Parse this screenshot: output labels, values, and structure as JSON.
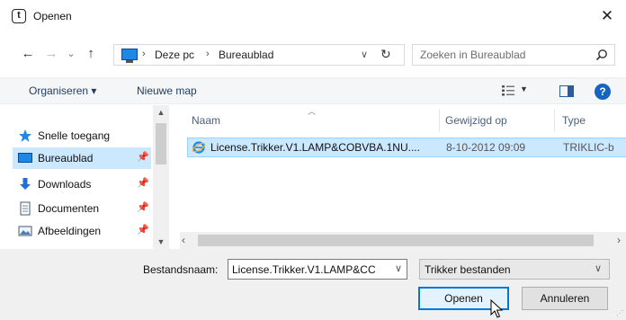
{
  "window": {
    "title": "Openen",
    "app_icon_letter": "t"
  },
  "nav": {
    "breadcrumbs": [
      "Deze pc",
      "Bureaublad"
    ],
    "search_placeholder": "Zoeken in Bureaublad"
  },
  "toolbar": {
    "organize": "Organiseren ▾",
    "new_folder": "Nieuwe map"
  },
  "sidebar": {
    "items": [
      {
        "label": "Snelle toegang"
      },
      {
        "label": "Bureaublad",
        "selected": true
      },
      {
        "label": "Downloads"
      },
      {
        "label": "Documenten"
      },
      {
        "label": "Afbeeldingen"
      }
    ]
  },
  "columns": [
    "Naam",
    "Gewijzigd op",
    "Type"
  ],
  "files": [
    {
      "name": "License.Trikker.V1.LAMP&COBVBA.1NU....",
      "date": "8-10-2012 09:09",
      "type": "TRIKLIC-b"
    }
  ],
  "footer": {
    "filename_label": "Bestandsnaam:",
    "filename_value": "License.Trikker.V1.LAMP&CC",
    "filetype": "Trikker bestanden",
    "open_label": "Openen",
    "cancel_label": "Annuleren"
  },
  "colors": {
    "accent": "#0078d7",
    "selection": "#cce8ff",
    "help": "#1565c0"
  }
}
